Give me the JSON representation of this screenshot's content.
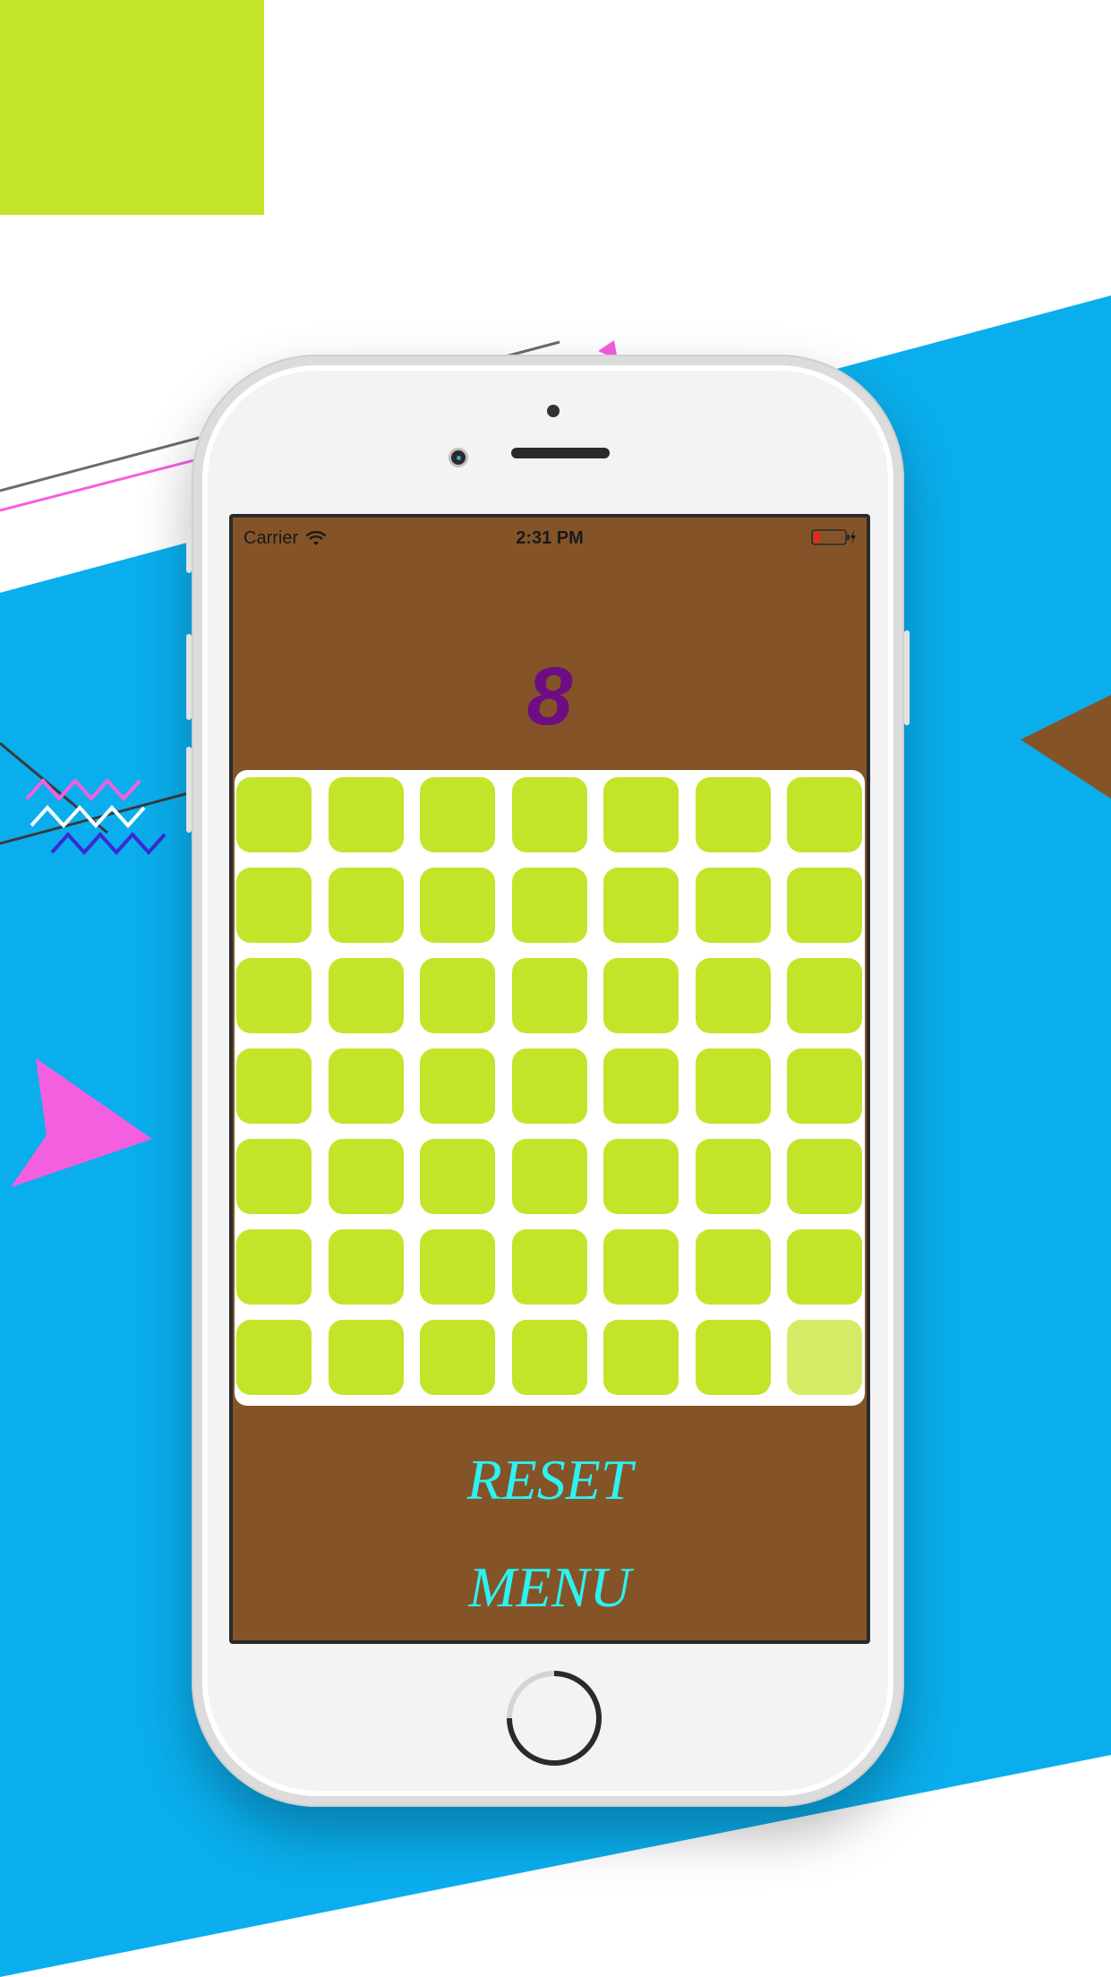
{
  "colors": {
    "background_blue": "#0aaeed",
    "accent_lime": "#c2e52a",
    "accent_pink": "#f45fe0",
    "accent_brown": "#845428",
    "screen_bg": "#845428",
    "score_color": "#6e0d83",
    "button_text": "#2df2f2",
    "tile_color": "#c2e52a",
    "tile_faded_color": "#d4eb66"
  },
  "status_bar": {
    "carrier": "Carrier",
    "time": "2:31 PM",
    "icons": [
      "wifi-icon",
      "battery-icon",
      "charging-icon"
    ]
  },
  "game": {
    "score": "8",
    "grid_rows": 7,
    "grid_cols": 7,
    "faded_tile": {
      "row": 7,
      "col": 7
    }
  },
  "buttons": {
    "reset_label": "RESET",
    "menu_label": "MENU"
  }
}
